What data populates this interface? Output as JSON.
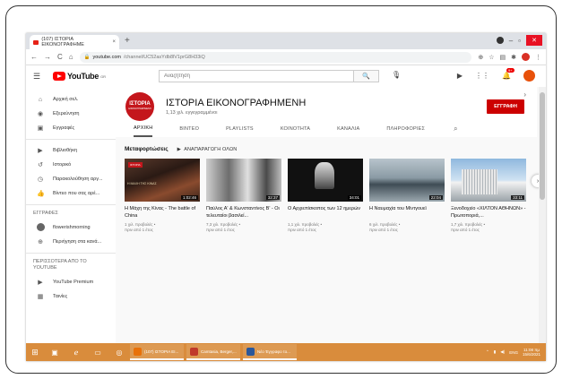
{
  "browser": {
    "tab_title": "(107) ΙΣΤΟΡΙΑ ΕΙΚΟΝΟΓΡΑΦΗΜΕ",
    "tab_close": "×",
    "new_tab": "+",
    "url_domain": "youtube.com",
    "url_path": "/channel/UC52asYdb8lV1prG8H33iQ"
  },
  "youtube": {
    "logo_text": "YouTube",
    "logo_region": "GR",
    "search_placeholder": "Αναζήτηση",
    "notification_count": "9+"
  },
  "sidebar": {
    "items": [
      {
        "label": "Αρχική σελ.",
        "icon": "home-icon"
      },
      {
        "label": "Εξερεύνηση",
        "icon": "explore-icon"
      },
      {
        "label": "Εγγραφές",
        "icon": "subscriptions-icon"
      }
    ],
    "library_items": [
      {
        "label": "Βιβλιοθήκη",
        "icon": "library-icon"
      },
      {
        "label": "Ιστορικό",
        "icon": "history-icon"
      },
      {
        "label": "Παρακολούθηση αργ...",
        "icon": "watch-later-icon"
      },
      {
        "label": "Βίντεο που σας αρέ...",
        "icon": "liked-icon"
      }
    ],
    "subscriptions_heading": "ΕΓΓΡΑΦΕΣ",
    "subscriptions": [
      {
        "label": "flowerishmorning"
      },
      {
        "label": "Περιήγηση στα κανά...",
        "icon": "add-circle-icon"
      }
    ],
    "more_heading": "ΠΕΡΙΣΣΟΤΕΡΑ ΑΠΟ ΤΟ YOUTUBE",
    "more_items": [
      {
        "label": "YouTube Premium",
        "icon": "youtube-icon"
      },
      {
        "label": "Ταινίες",
        "icon": "movies-icon"
      }
    ]
  },
  "channel": {
    "logo_text": "ΙΣΤΟΡΙΑ",
    "logo_sub": "ΕΙΚΟΝΟΓΡΑΦΗΜΕΝΗ",
    "name": "ΙΣΤΟΡΙΑ ΕΙΚΟΝΟΓΡΑΦΗΜΕΝΗ",
    "subscribers": "1,13 χιλ. εγγεγραμμένοι",
    "subscribe_label": "ΕΓΓΡΑΦΗ",
    "tabs": [
      "ΑΡΧΙΚΗ",
      "ΒΙΝΤΕΟ",
      "PLAYLISTS",
      "ΚΟΙΝΟΤΗΤΑ",
      "ΚΑΝΑΛΙΑ",
      "ΠΛΗΡΟΦΟΡΙΕΣ"
    ],
    "active_tab": "ΑΡΧΙΚΗ"
  },
  "shelf": {
    "title": "Μεταφορτώσεις",
    "play_all": "ΑΝΑΠΑΡΑΓΩΓΗ ΟΛΩΝ"
  },
  "videos": [
    {
      "title": "Η Μάχη της Κίνας - The battle of China",
      "views": "1 χιλ. προβολές",
      "age": "πριν από 1 έτος",
      "duration": "1:02:46",
      "thumb_caption": "Η ΜΑΧΗ ΤΗΣ ΚΙΝΑΣ",
      "thumb_badge": "ΙΣΤΟΡΙΑ"
    },
    {
      "title": "Παύλος Α' & Κωνσταντίνος Β' - Οι τελευταίοι βασιλεί...",
      "views": "7,3 χιλ. προβολές",
      "age": "πριν από 1 έτος",
      "duration": "32:37"
    },
    {
      "title": "Ο Αρχιεπίσκοπος των 12 ημερών",
      "views": "1,1 χιλ. προβολές",
      "age": "πριν από 1 έτος",
      "duration": "34:01"
    },
    {
      "title": "Η Ναυμαχία του Μίντγουεϊ",
      "views": "6 χιλ. προβολές",
      "age": "πριν από 1 έτος",
      "duration": "22:04"
    },
    {
      "title": "Ξενοδοχείο «ΧΙΛΤΟΝ ΑΘΗΝΩΝ» - Πρωτοποριά,...",
      "views": "1,7 χιλ. προβολές",
      "age": "πριν από 1 έτος",
      "duration": "33:11"
    }
  ],
  "taskbar": {
    "apps": [
      {
        "label": "(107) ΙΣΤΟΡΙΑ ΕΙ...",
        "color": "#e8710a"
      },
      {
        "label": "Camtasia, Berger,...",
        "color": "#c0392b"
      },
      {
        "label": "Νέο Έγγραφο το...",
        "color": "#2b579a"
      }
    ],
    "lang": "ENG",
    "time": "11:08 πμ",
    "date": "15/6/2021"
  }
}
